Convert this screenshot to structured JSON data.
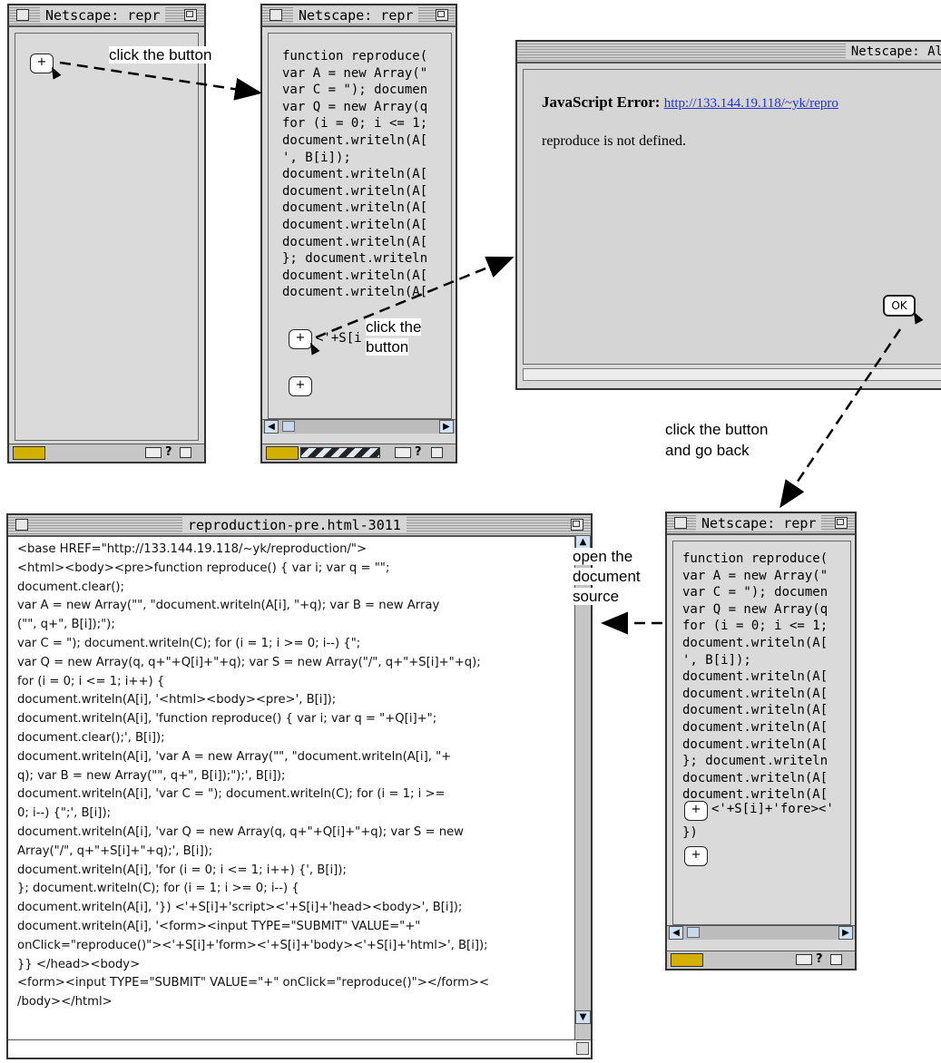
{
  "windows": {
    "w1": {
      "title": "Netscape: repr",
      "button": "+"
    },
    "w2": {
      "title": "Netscape: repr",
      "lines": [
        "function reproduce(",
        "var A = new Array(\"",
        "var C = \"); documen",
        "var Q = new Array(q",
        "for (i = 0; i <= 1;",
        "document.writeln(A[",
        "', B[i]);",
        "document.writeln(A[",
        "document.writeln(A[",
        "document.writeln(A[",
        "document.writeln(A[",
        "document.writeln(A[",
        "}; document.writeln",
        "document.writeln(A[",
        "document.writeln(A["
      ],
      "button_row_text": "<'+S[i",
      "button": "+"
    },
    "alert": {
      "title": "Netscape: Al",
      "error_label": "JavaScript Error:",
      "error_url": "http://133.144.19.118/~yk/repro",
      "message": "reproduce is not defined.",
      "ok_label": "OK"
    },
    "w4": {
      "title": "Netscape: repr",
      "lines": [
        "function reproduce(",
        "var A = new Array(\"",
        "var C = \"); documen",
        "var Q = new Array(q",
        "for (i = 0; i <= 1;",
        "document.writeln(A[",
        "', B[i]);",
        "document.writeln(A[",
        "document.writeln(A[",
        "document.writeln(A[",
        "document.writeln(A[",
        "document.writeln(A[",
        "}; document.writeln",
        "document.writeln(A[",
        "document.writeln(A["
      ],
      "button_row_text": "<'+S[i]+'fore><'",
      "after_button": "})",
      "button": "+"
    },
    "source": {
      "title": "reproduction-pre.html-3011",
      "lines": [
        "<base HREF=\"http://133.144.19.118/~yk/reproduction/\">",
        "<html><body><pre>function reproduce() { var i; var q = \"\";",
        "document.clear();",
        "var A = new Array(\"\", \"document.writeln(A[i], \"+q); var B = new Array",
        "(\"\", q+\", B[i]);\");",
        "var C = \"); document.writeln(C); for (i = 1; i >= 0; i--) {\";",
        "var Q = new Array(q, q+\"+Q[i]+\"+q); var S = new Array(\"/\", q+\"+S[i]+\"+q);",
        "for (i = 0; i <= 1; i++) {",
        "document.writeln(A[i], '<html><body><pre>', B[i]);",
        "document.writeln(A[i], 'function reproduce() { var i; var q = \"+Q[i]+\";",
        "document.clear();', B[i]);",
        "document.writeln(A[i], 'var A = new Array(\"\", \"document.writeln(A[i], \"+",
        "q); var B = new Array(\"\", q+\", B[i]);\");', B[i]);",
        "document.writeln(A[i], 'var C = \"); document.writeln(C); for (i = 1; i >=",
        "0; i--) {\";', B[i]);",
        "document.writeln(A[i], 'var Q = new Array(q, q+\"+Q[i]+\"+q); var S = new",
        "Array(\"/\", q+\"+S[i]+\"+q);', B[i]);",
        "document.writeln(A[i], 'for (i = 0; i <= 1; i++) {', B[i]);",
        "}; document.writeln(C); for (i = 1; i >= 0; i--) {",
        "document.writeln(A[i], '}) <'+S[i]+'script><'+S[i]+'head><body>', B[i]);",
        "document.writeln(A[i], '<form><input TYPE=\"SUBMIT\" VALUE=\"+\"",
        "onClick=\"reproduce()\"><'+S[i]+'form><'+S[i]+'body><'+S[i]+'html>', B[i]);",
        "}} </head><body>",
        "<form><input TYPE=\"SUBMIT\" VALUE=\"+\" onClick=\"reproduce()\"></form><",
        "/body></html>"
      ]
    }
  },
  "captions": {
    "c1": "click the button",
    "c2a": "click the",
    "c2b": "button",
    "c3a": "click the button",
    "c3b": "and go back",
    "c4a": "open the",
    "c4b": "document",
    "c4c": "source"
  }
}
